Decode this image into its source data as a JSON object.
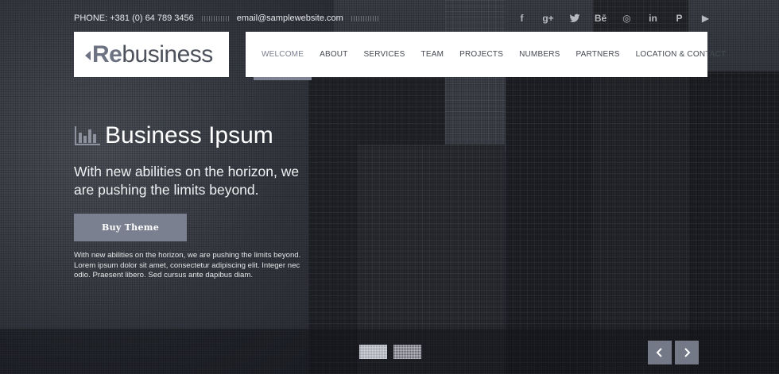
{
  "topbar": {
    "phone": "PHONE: +381 (0) 64 789 3456",
    "email": "email@samplewebsite.com"
  },
  "social": [
    {
      "icon": "facebook-icon",
      "glyph": "f"
    },
    {
      "icon": "google-plus-icon",
      "glyph": "g+"
    },
    {
      "icon": "twitter-icon",
      "glyph": "t"
    },
    {
      "icon": "behance-icon",
      "glyph": "Bē"
    },
    {
      "icon": "dribbble-icon",
      "glyph": "◎"
    },
    {
      "icon": "linkedin-icon",
      "glyph": "in"
    },
    {
      "icon": "pinterest-icon",
      "glyph": "P"
    },
    {
      "icon": "youtube-icon",
      "glyph": "▶"
    }
  ],
  "logo": {
    "prefix": "Re",
    "suffix": "business",
    "accent": "#6d7382"
  },
  "nav": {
    "items": [
      {
        "label": "WELCOME",
        "active": true
      },
      {
        "label": "ABOUT"
      },
      {
        "label": "SERVICES"
      },
      {
        "label": "TEAM"
      },
      {
        "label": "PROJECTS"
      },
      {
        "label": "NUMBERS"
      },
      {
        "label": "PARTNERS"
      },
      {
        "label": "LOCATION & CONTACT"
      }
    ]
  },
  "hero": {
    "title": "Business Ipsum",
    "icon": "bar-chart-icon",
    "subtitle": "With new abilities on the horizon, we are pushing the limits beyond.",
    "button": "Buy Theme",
    "body": "With new abilities on the horizon, we are pushing the limits beyond. Lorem ipsum dolor sit amet, consectetur adipiscing elit. Integer nec odio. Praesent libero. Sed cursus ante dapibus diam."
  },
  "slider": {
    "pages": 2,
    "current": 1,
    "prev_icon": "chevron-left-icon",
    "next_icon": "chevron-right-icon"
  },
  "colors": {
    "button": "#7a8090",
    "nav_active": "#7d8392",
    "background": "#2b2e36"
  }
}
